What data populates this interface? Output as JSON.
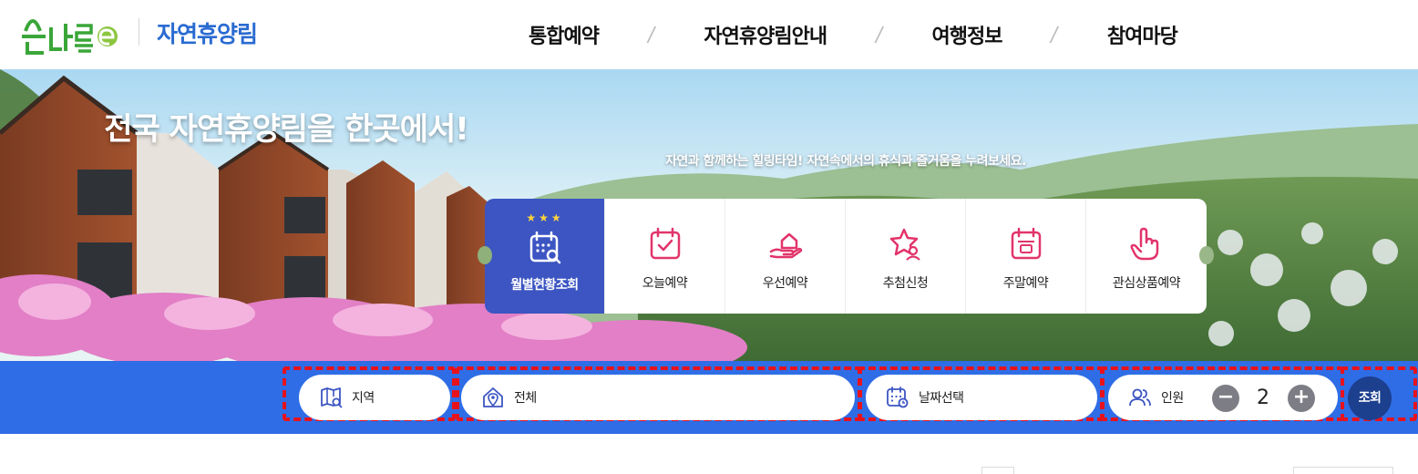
{
  "header": {
    "logo_text": "숲나들e",
    "site_name": "자연휴양림",
    "nav": [
      {
        "label": "통합예약"
      },
      {
        "label": "자연휴양림안내"
      },
      {
        "label": "여행정보"
      },
      {
        "label": "참여마당"
      }
    ],
    "nav_separator": "/"
  },
  "hero": {
    "title": "전국 자연휴양림을 한곳에서!",
    "subtitle": "자연과 함께하는 힐링타임! 자연속에서의 휴식과 즐거움을 누려보세요."
  },
  "quick_menu": {
    "stars": "★★★",
    "items": [
      {
        "label": "월별현황조회",
        "icon": "calendar-search-icon",
        "active": true
      },
      {
        "label": "오늘예약",
        "icon": "calendar-check-icon",
        "active": false
      },
      {
        "label": "우선예약",
        "icon": "hand-house-icon",
        "active": false
      },
      {
        "label": "추첨신청",
        "icon": "star-person-icon",
        "active": false
      },
      {
        "label": "주말예약",
        "icon": "calendar-weekend-icon",
        "active": false
      },
      {
        "label": "관심상품예약",
        "icon": "pointing-hand-icon",
        "active": false
      }
    ]
  },
  "search": {
    "region_label": "지역",
    "facility_label": "전체",
    "date_label": "날짜선택",
    "people_label": "인원",
    "people_count": "2",
    "minus": "−",
    "plus": "+",
    "submit_label": "조회"
  },
  "colors": {
    "brand_blue": "#2a6bd1",
    "search_bar": "#2f6de6",
    "active_card": "#3c55c2",
    "icon_pink": "#e2346b",
    "submit_button": "#1c3f8e",
    "highlight_dash": "#e8121c"
  }
}
